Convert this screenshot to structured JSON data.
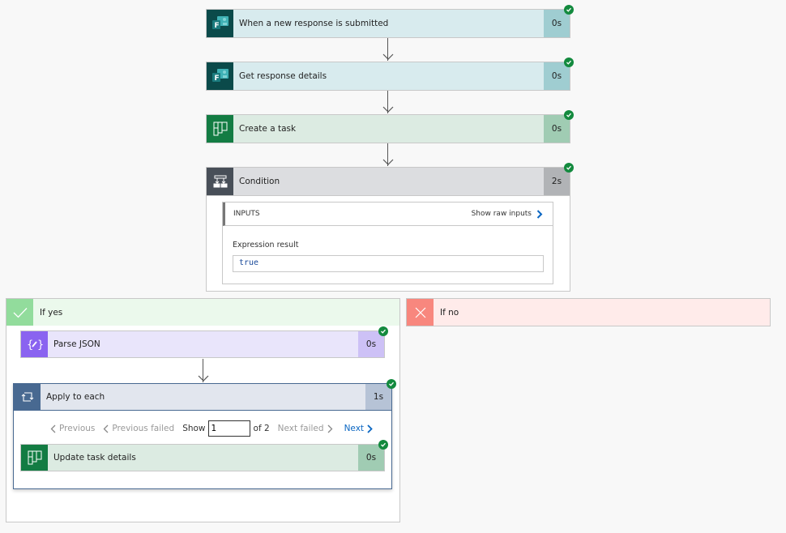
{
  "steps": [
    {
      "title": "When a new response is submitted",
      "duration": "0s",
      "icon": "forms-icon",
      "status": "succeeded"
    },
    {
      "title": "Get response details",
      "duration": "0s",
      "icon": "forms-icon",
      "status": "succeeded"
    },
    {
      "title": "Create a task",
      "duration": "0s",
      "icon": "planner-icon",
      "status": "succeeded"
    },
    {
      "title": "Condition",
      "duration": "2s",
      "icon": "condition-icon",
      "status": "succeeded"
    }
  ],
  "condition": {
    "inputs_label": "INPUTS",
    "show_raw_inputs": "Show raw inputs",
    "expression_label": "Expression result",
    "expression_value": "true"
  },
  "branches": {
    "yes_label": "If yes",
    "no_label": "If no"
  },
  "yes_steps": {
    "parse_json": {
      "title": "Parse JSON",
      "duration": "0s"
    },
    "apply_to_each": {
      "title": "Apply to each",
      "duration": "1s"
    },
    "update_task": {
      "title": "Update task details",
      "duration": "0s"
    }
  },
  "pager": {
    "previous": "Previous",
    "previous_failed": "Previous failed",
    "show_label": "Show",
    "current": "1",
    "of_total": "of 2",
    "next_failed": "Next failed",
    "next": "Next"
  },
  "colors": {
    "success": "#138a3e",
    "link": "#0a66c2",
    "forms": "#0b4a4a",
    "planner": "#137c43",
    "condition": "#484f58",
    "parse_json": "#8a63f0",
    "loop": "#486991",
    "yes_accent": "#92dc9c",
    "no_accent": "#f8877e"
  }
}
